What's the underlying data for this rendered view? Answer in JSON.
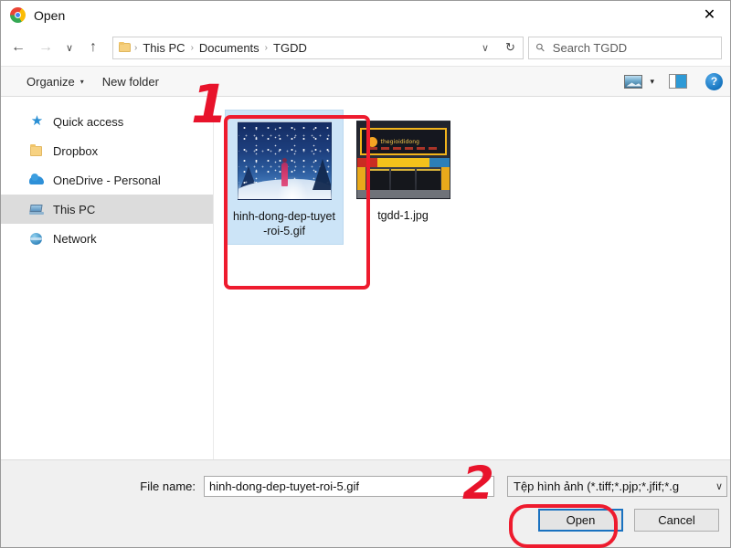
{
  "window": {
    "app_icon": "chrome-logo-icon",
    "title": "Open",
    "close_label": "✕"
  },
  "nav": {
    "back": "←",
    "forward": "→",
    "recent": "∨",
    "up": "↑",
    "refresh": "↻",
    "breadcrumb": {
      "folder_icon": "folder-icon",
      "items": [
        "This PC",
        "Documents",
        "TGDD"
      ],
      "separator": "›",
      "dropdown": "∨"
    },
    "search": {
      "icon": "search-icon",
      "placeholder": "Search TGDD"
    }
  },
  "command_bar": {
    "organize": "Organize",
    "organize_caret": "▾",
    "new_folder": "New folder",
    "view_icon": "view-mode-picture-icon",
    "view_caret": "▾",
    "preview_pane_icon": "preview-pane-icon",
    "help": "?"
  },
  "sidebar": {
    "items": [
      {
        "label": "Quick access",
        "icon": "star-icon",
        "selected": false
      },
      {
        "label": "Dropbox",
        "icon": "folder-icon",
        "selected": false
      },
      {
        "label": "OneDrive - Personal",
        "icon": "cloud-icon",
        "selected": false
      },
      {
        "label": "This PC",
        "icon": "computer-icon",
        "selected": true
      },
      {
        "label": "Network",
        "icon": "network-globe-icon",
        "selected": false
      }
    ]
  },
  "files": [
    {
      "name": "hinh-dong-dep-tuyet-roi-5.gif",
      "thumbnail": "snowy-night-scene",
      "selected": true
    },
    {
      "name": "tgdd-1.jpg",
      "thumbnail": "thegioididong-storefront",
      "selected": false
    }
  ],
  "shop_thumbnail": {
    "brand": "thegioididong"
  },
  "bottom": {
    "filename_label": "File name:",
    "filename_value": "hinh-dong-dep-tuyet-roi-5.gif",
    "filetype_value": "Tệp hình ảnh (*.tiff;*.pjp;*.jfif;*.g",
    "filetype_caret": "∨",
    "open_button": "Open",
    "cancel_button": "Cancel"
  },
  "annotations": {
    "step_one": "1",
    "step_two": "2",
    "color": "#ee1b2e"
  }
}
